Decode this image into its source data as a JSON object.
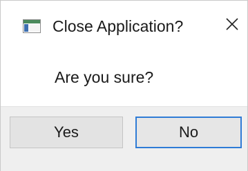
{
  "dialog": {
    "title": "Close Application?",
    "message": "Are you sure?",
    "icons": {
      "app": "application-window-icon",
      "close": "close-icon"
    },
    "buttons": {
      "yes_label": "Yes",
      "no_label": "No"
    },
    "colors": {
      "focus_border": "#2e7bd6",
      "footer_bg": "#efefef",
      "button_bg": "#e3e3e3"
    }
  }
}
